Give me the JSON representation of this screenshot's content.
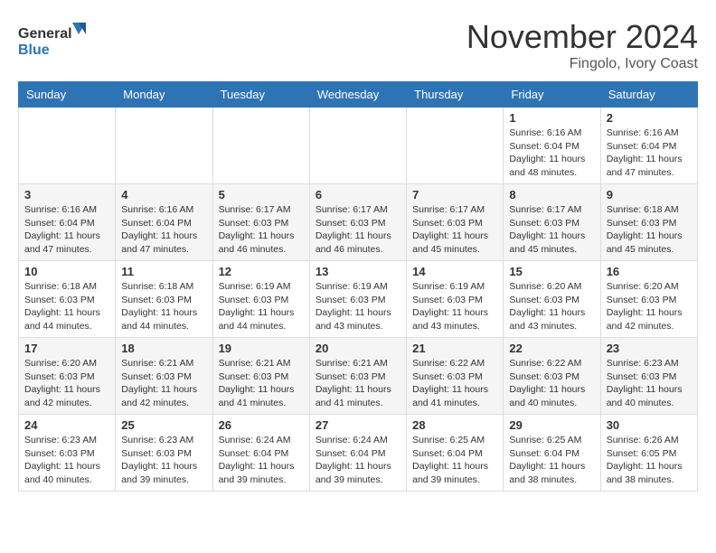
{
  "header": {
    "logo": {
      "general": "General",
      "blue": "Blue"
    },
    "title": "November 2024",
    "location": "Fingolo, Ivory Coast"
  },
  "calendar": {
    "weekdays": [
      "Sunday",
      "Monday",
      "Tuesday",
      "Wednesday",
      "Thursday",
      "Friday",
      "Saturday"
    ],
    "weeks": [
      [
        {
          "day": "",
          "info": ""
        },
        {
          "day": "",
          "info": ""
        },
        {
          "day": "",
          "info": ""
        },
        {
          "day": "",
          "info": ""
        },
        {
          "day": "",
          "info": ""
        },
        {
          "day": "1",
          "info": "Sunrise: 6:16 AM\nSunset: 6:04 PM\nDaylight: 11 hours\nand 48 minutes."
        },
        {
          "day": "2",
          "info": "Sunrise: 6:16 AM\nSunset: 6:04 PM\nDaylight: 11 hours\nand 47 minutes."
        }
      ],
      [
        {
          "day": "3",
          "info": "Sunrise: 6:16 AM\nSunset: 6:04 PM\nDaylight: 11 hours\nand 47 minutes."
        },
        {
          "day": "4",
          "info": "Sunrise: 6:16 AM\nSunset: 6:04 PM\nDaylight: 11 hours\nand 47 minutes."
        },
        {
          "day": "5",
          "info": "Sunrise: 6:17 AM\nSunset: 6:03 PM\nDaylight: 11 hours\nand 46 minutes."
        },
        {
          "day": "6",
          "info": "Sunrise: 6:17 AM\nSunset: 6:03 PM\nDaylight: 11 hours\nand 46 minutes."
        },
        {
          "day": "7",
          "info": "Sunrise: 6:17 AM\nSunset: 6:03 PM\nDaylight: 11 hours\nand 45 minutes."
        },
        {
          "day": "8",
          "info": "Sunrise: 6:17 AM\nSunset: 6:03 PM\nDaylight: 11 hours\nand 45 minutes."
        },
        {
          "day": "9",
          "info": "Sunrise: 6:18 AM\nSunset: 6:03 PM\nDaylight: 11 hours\nand 45 minutes."
        }
      ],
      [
        {
          "day": "10",
          "info": "Sunrise: 6:18 AM\nSunset: 6:03 PM\nDaylight: 11 hours\nand 44 minutes."
        },
        {
          "day": "11",
          "info": "Sunrise: 6:18 AM\nSunset: 6:03 PM\nDaylight: 11 hours\nand 44 minutes."
        },
        {
          "day": "12",
          "info": "Sunrise: 6:19 AM\nSunset: 6:03 PM\nDaylight: 11 hours\nand 44 minutes."
        },
        {
          "day": "13",
          "info": "Sunrise: 6:19 AM\nSunset: 6:03 PM\nDaylight: 11 hours\nand 43 minutes."
        },
        {
          "day": "14",
          "info": "Sunrise: 6:19 AM\nSunset: 6:03 PM\nDaylight: 11 hours\nand 43 minutes."
        },
        {
          "day": "15",
          "info": "Sunrise: 6:20 AM\nSunset: 6:03 PM\nDaylight: 11 hours\nand 43 minutes."
        },
        {
          "day": "16",
          "info": "Sunrise: 6:20 AM\nSunset: 6:03 PM\nDaylight: 11 hours\nand 42 minutes."
        }
      ],
      [
        {
          "day": "17",
          "info": "Sunrise: 6:20 AM\nSunset: 6:03 PM\nDaylight: 11 hours\nand 42 minutes."
        },
        {
          "day": "18",
          "info": "Sunrise: 6:21 AM\nSunset: 6:03 PM\nDaylight: 11 hours\nand 42 minutes."
        },
        {
          "day": "19",
          "info": "Sunrise: 6:21 AM\nSunset: 6:03 PM\nDaylight: 11 hours\nand 41 minutes."
        },
        {
          "day": "20",
          "info": "Sunrise: 6:21 AM\nSunset: 6:03 PM\nDaylight: 11 hours\nand 41 minutes."
        },
        {
          "day": "21",
          "info": "Sunrise: 6:22 AM\nSunset: 6:03 PM\nDaylight: 11 hours\nand 41 minutes."
        },
        {
          "day": "22",
          "info": "Sunrise: 6:22 AM\nSunset: 6:03 PM\nDaylight: 11 hours\nand 40 minutes."
        },
        {
          "day": "23",
          "info": "Sunrise: 6:23 AM\nSunset: 6:03 PM\nDaylight: 11 hours\nand 40 minutes."
        }
      ],
      [
        {
          "day": "24",
          "info": "Sunrise: 6:23 AM\nSunset: 6:03 PM\nDaylight: 11 hours\nand 40 minutes."
        },
        {
          "day": "25",
          "info": "Sunrise: 6:23 AM\nSunset: 6:03 PM\nDaylight: 11 hours\nand 39 minutes."
        },
        {
          "day": "26",
          "info": "Sunrise: 6:24 AM\nSunset: 6:04 PM\nDaylight: 11 hours\nand 39 minutes."
        },
        {
          "day": "27",
          "info": "Sunrise: 6:24 AM\nSunset: 6:04 PM\nDaylight: 11 hours\nand 39 minutes."
        },
        {
          "day": "28",
          "info": "Sunrise: 6:25 AM\nSunset: 6:04 PM\nDaylight: 11 hours\nand 39 minutes."
        },
        {
          "day": "29",
          "info": "Sunrise: 6:25 AM\nSunset: 6:04 PM\nDaylight: 11 hours\nand 38 minutes."
        },
        {
          "day": "30",
          "info": "Sunrise: 6:26 AM\nSunset: 6:05 PM\nDaylight: 11 hours\nand 38 minutes."
        }
      ]
    ]
  }
}
